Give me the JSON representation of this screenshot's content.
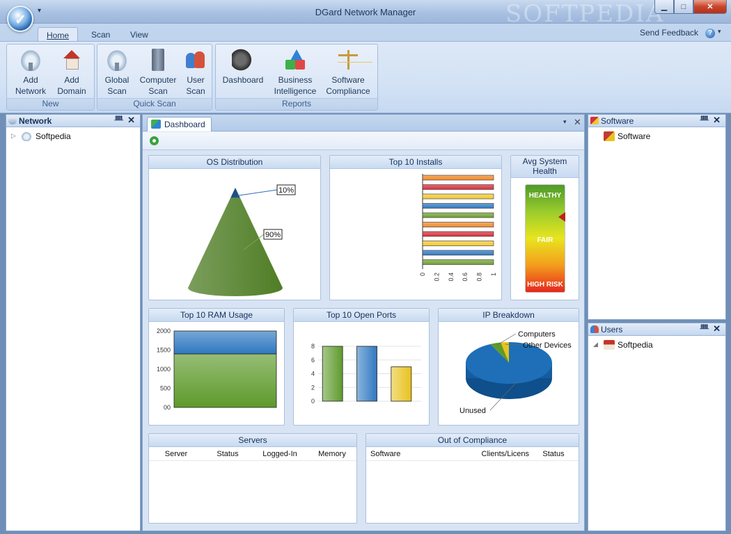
{
  "window": {
    "title": "DGard Network Manager",
    "watermark": "SOFTPEDIA",
    "qat_glyph": "▾",
    "minimize": "▁",
    "maximize": "□",
    "close": "✕"
  },
  "ribbon": {
    "tabs": [
      {
        "label": "Home",
        "active": true
      },
      {
        "label": "Scan",
        "active": false
      },
      {
        "label": "View",
        "active": false
      }
    ],
    "send_feedback": "Send Feedback",
    "help_glyph": "?",
    "help_chevron": "▾",
    "groups": [
      {
        "label": "New",
        "buttons": [
          {
            "label": "Add\nNetwork",
            "icon": "network-cloud-icon"
          },
          {
            "label": "Add\nDomain",
            "icon": "house-icon"
          }
        ]
      },
      {
        "label": "Quick Scan",
        "buttons": [
          {
            "label": "Global\nScan",
            "icon": "network-cloud-icon"
          },
          {
            "label": "Computer\nScan",
            "icon": "computer-icon"
          },
          {
            "label": "User\nScan",
            "icon": "users-icon"
          }
        ]
      },
      {
        "label": "Reports",
        "buttons": [
          {
            "label": "Dashboard",
            "icon": "dashboard-icon"
          },
          {
            "label": "Business\nIntelligence",
            "icon": "business-intelligence-icon"
          },
          {
            "label": "Software\nCompliance",
            "icon": "scale-icon"
          }
        ]
      }
    ]
  },
  "network_pane": {
    "title": "Network",
    "pin": "ᚙ",
    "close": "✕",
    "tree": [
      {
        "label": "Softpedia",
        "expander": "▷"
      }
    ]
  },
  "software_pane": {
    "title": "Software",
    "pin": "ᚙ",
    "close": "✕",
    "tree": [
      {
        "label": "Software"
      }
    ]
  },
  "users_pane": {
    "title": "Users",
    "pin": "ᚙ",
    "close": "✕",
    "tree": [
      {
        "label": "Softpedia",
        "expander": "◢"
      }
    ]
  },
  "dashboard": {
    "tab_label": "Dashboard",
    "menu_glyph": "▾",
    "close_glyph": "✕",
    "widgets": {
      "os_distribution": {
        "title": "OS Distribution"
      },
      "top_installs": {
        "title": "Top 10 Installs"
      },
      "avg_health": {
        "title": "Avg System\nHealth",
        "levels": [
          "HEALTHY",
          "FAIR",
          "HIGH RISK"
        ],
        "indicator": 0.3,
        "indicator_color": "#c0201f"
      },
      "top_ram": {
        "title": "Top 10 RAM Usage"
      },
      "top_ports": {
        "title": "Top 10 Open Ports"
      },
      "ip_breakdown": {
        "title": "IP Breakdown"
      },
      "servers": {
        "title": "Servers",
        "columns": [
          "Server",
          "Status",
          "Logged-In",
          "Memory"
        ],
        "rows": []
      },
      "out_of_compliance": {
        "title": "Out of Compliance",
        "columns": [
          "Software",
          "Clients/Licens",
          "Status"
        ],
        "rows": []
      }
    }
  },
  "chart_data": [
    {
      "type": "pie",
      "variant": "cone",
      "title": "OS Distribution",
      "slices": [
        {
          "label": "10%",
          "value": 10,
          "color": "#1d4f86"
        },
        {
          "label": "90%",
          "value": 90,
          "color": "#4f7d25"
        }
      ]
    },
    {
      "type": "bar",
      "orientation": "horizontal",
      "title": "Top 10 Installs",
      "categories": [
        "",
        "",
        "",
        "",
        "",
        "",
        "",
        "",
        "",
        ""
      ],
      "values": [
        1,
        1,
        1,
        1,
        1,
        1,
        1,
        1,
        1,
        1
      ],
      "colors": [
        "#f08a2a",
        "#d6303a",
        "#f0c832",
        "#2e78c0",
        "#6fa032",
        "#f08a2a",
        "#d6303a",
        "#f0c832",
        "#2e78c0",
        "#6fa032"
      ],
      "xlim": [
        0,
        1
      ],
      "xticks": [
        "0",
        "0.2",
        "0.4",
        "0.6",
        "0.8",
        "1"
      ]
    },
    {
      "type": "bar",
      "variant": "stacked",
      "title": "Top 10 RAM Usage",
      "categories": [
        ""
      ],
      "series": [
        {
          "values": [
            1400
          ],
          "color": "#5e9a2b"
        },
        {
          "values": [
            600
          ],
          "color": "#2e78c0"
        }
      ],
      "ylim": [
        0,
        2000
      ],
      "yticks": [
        "00",
        "500",
        "1000",
        "1500",
        "2000"
      ]
    },
    {
      "type": "bar",
      "title": "Top 10 Open Ports",
      "categories": [
        "",
        "",
        ""
      ],
      "values": [
        8,
        8,
        5
      ],
      "colors": [
        "#5e9a2b",
        "#2e78c0",
        "#e8c21e"
      ],
      "ylim": [
        0,
        8
      ],
      "yticks": [
        "0",
        "2",
        "4",
        "6",
        "8"
      ]
    },
    {
      "type": "pie",
      "title": "IP Breakdown",
      "slices": [
        {
          "label": "Unused",
          "value": 93,
          "color": "#1e6fb8"
        },
        {
          "label": "Computers",
          "value": 4,
          "color": "#5e9a2b"
        },
        {
          "label": "Other Devices",
          "value": 3,
          "color": "#e8c21e"
        }
      ]
    }
  ]
}
